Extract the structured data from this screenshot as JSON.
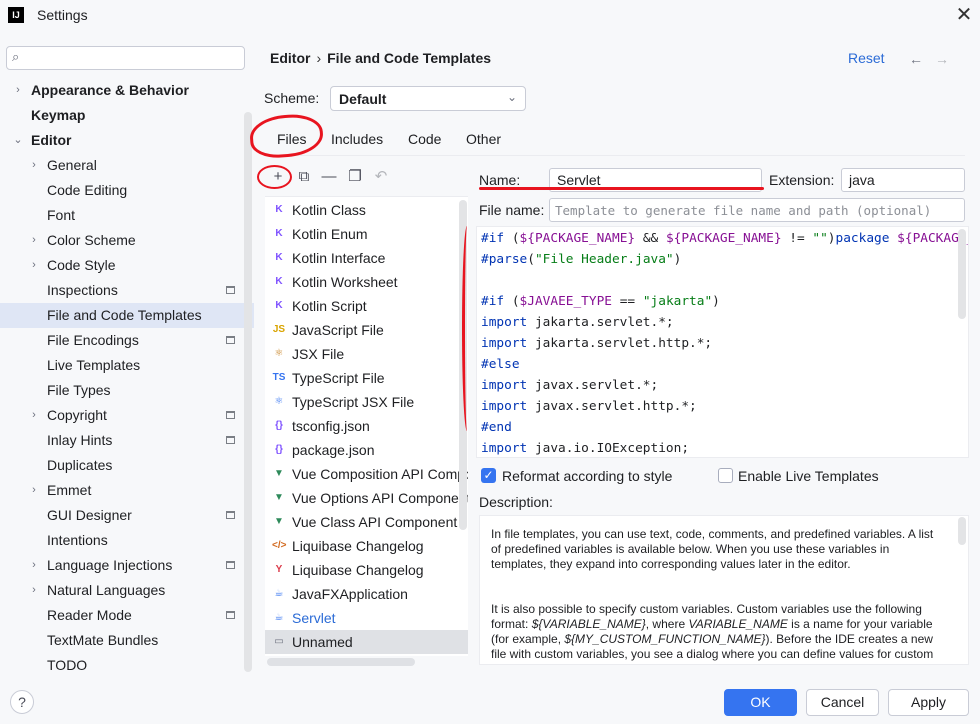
{
  "window": {
    "title": "Settings",
    "app_icon": "IJ",
    "close_glyph": "✕"
  },
  "search": {
    "placeholder": "",
    "icon": "search-icon",
    "glyph": "⌕"
  },
  "sidebar": {
    "items": [
      {
        "label": "Appearance & Behavior",
        "level": 0,
        "arrow": "›",
        "bold": true
      },
      {
        "label": "Keymap",
        "level": 0,
        "arrow": "",
        "bold": true
      },
      {
        "label": "Editor",
        "level": 0,
        "arrow": "⌄",
        "bold": true
      },
      {
        "label": "General",
        "level": 1,
        "arrow": "›"
      },
      {
        "label": "Code Editing",
        "level": 1,
        "arrow": ""
      },
      {
        "label": "Font",
        "level": 1,
        "arrow": ""
      },
      {
        "label": "Color Scheme",
        "level": 1,
        "arrow": "›"
      },
      {
        "label": "Code Style",
        "level": 1,
        "arrow": "›"
      },
      {
        "label": "Inspections",
        "level": 1,
        "arrow": "",
        "pin": true
      },
      {
        "label": "File and Code Templates",
        "level": 1,
        "arrow": "",
        "selected": true
      },
      {
        "label": "File Encodings",
        "level": 1,
        "arrow": "",
        "pin": true
      },
      {
        "label": "Live Templates",
        "level": 1,
        "arrow": ""
      },
      {
        "label": "File Types",
        "level": 1,
        "arrow": ""
      },
      {
        "label": "Copyright",
        "level": 1,
        "arrow": "›",
        "pin": true
      },
      {
        "label": "Inlay Hints",
        "level": 1,
        "arrow": "",
        "pin": true
      },
      {
        "label": "Duplicates",
        "level": 1,
        "arrow": ""
      },
      {
        "label": "Emmet",
        "level": 1,
        "arrow": "›"
      },
      {
        "label": "GUI Designer",
        "level": 1,
        "arrow": "",
        "pin": true
      },
      {
        "label": "Intentions",
        "level": 1,
        "arrow": ""
      },
      {
        "label": "Language Injections",
        "level": 1,
        "arrow": "›",
        "pin": true
      },
      {
        "label": "Natural Languages",
        "level": 1,
        "arrow": "›"
      },
      {
        "label": "Reader Mode",
        "level": 1,
        "arrow": "",
        "pin": true
      },
      {
        "label": "TextMate Bundles",
        "level": 1,
        "arrow": ""
      },
      {
        "label": "TODO",
        "level": 1,
        "arrow": ""
      }
    ]
  },
  "header": {
    "breadcrumb": [
      "Editor",
      "File and Code Templates"
    ],
    "breadcrumb_sep": "›",
    "reset": "Reset",
    "back": "←",
    "forward": "→"
  },
  "scheme": {
    "label": "Scheme:",
    "value": "Default",
    "chevron": "⌄"
  },
  "tabs": {
    "files": "Files",
    "includes": "Includes",
    "code": "Code",
    "other": "Other",
    "active": "Files"
  },
  "toolbar": {
    "add": "+",
    "copy_add": "⧉",
    "remove": "—",
    "duplicate": "❐",
    "reset": "↶",
    "icons": [
      "plus-icon",
      "add-copy-icon",
      "minus-icon",
      "copy-icon",
      "undo-icon"
    ]
  },
  "templates": [
    {
      "label": "Kotlin Class",
      "icon": "kotlin-icon",
      "glyph": "K",
      "color": "#7f52ff"
    },
    {
      "label": "Kotlin Enum",
      "icon": "kotlin-icon",
      "glyph": "K",
      "color": "#7f52ff"
    },
    {
      "label": "Kotlin Interface",
      "icon": "kotlin-icon",
      "glyph": "K",
      "color": "#7f52ff"
    },
    {
      "label": "Kotlin Worksheet",
      "icon": "kotlin-icon",
      "glyph": "K",
      "color": "#7f52ff"
    },
    {
      "label": "Kotlin Script",
      "icon": "kotlin-icon",
      "glyph": "K",
      "color": "#7f52ff"
    },
    {
      "label": "JavaScript File",
      "icon": "javascript-icon",
      "glyph": "JS",
      "color": "#d9a400"
    },
    {
      "label": "JSX File",
      "icon": "react-icon",
      "glyph": "⚛",
      "color": "#c57e1b"
    },
    {
      "label": "TypeScript File",
      "icon": "typescript-icon",
      "glyph": "TS",
      "color": "#3574f0"
    },
    {
      "label": "TypeScript JSX File",
      "icon": "react-icon",
      "glyph": "⚛",
      "color": "#3574f0"
    },
    {
      "label": "tsconfig.json",
      "icon": "json-icon",
      "glyph": "{}",
      "color": "#7f52ff"
    },
    {
      "label": "package.json",
      "icon": "json-icon",
      "glyph": "{}",
      "color": "#7f52ff"
    },
    {
      "label": "Vue Composition API Component",
      "icon": "vue-icon",
      "glyph": "▼",
      "color": "#2e8a5a"
    },
    {
      "label": "Vue Options API Component",
      "icon": "vue-icon",
      "glyph": "▼",
      "color": "#2e8a5a"
    },
    {
      "label": "Vue Class API Component",
      "icon": "vue-icon",
      "glyph": "▼",
      "color": "#2e8a5a"
    },
    {
      "label": "Liquibase Changelog",
      "icon": "xml-icon",
      "glyph": "</>",
      "color": "#d2691e"
    },
    {
      "label": "Liquibase Changelog",
      "icon": "yaml-icon",
      "glyph": "Y",
      "color": "#db3b4b"
    },
    {
      "label": "JavaFXApplication",
      "icon": "javafx-icon",
      "glyph": "☕",
      "color": "#3574f0"
    },
    {
      "label": "Servlet",
      "icon": "servlet-icon",
      "glyph": "☕",
      "color": "#3574f0",
      "link": true
    },
    {
      "label": "Unnamed",
      "icon": "file-icon",
      "glyph": "▭",
      "color": "#6c707e",
      "selected": true
    }
  ],
  "form": {
    "name_label": "Name:",
    "name_value": "Servlet",
    "extension_label": "Extension:",
    "extension_value": "java",
    "filename_label": "File name:",
    "filename_placeholder": "Template to generate file name and path (optional)"
  },
  "editor": {
    "lines": [
      "#if (${PACKAGE_NAME} && ${PACKAGE_NAME} != \"\")package ${PACKAGE_NAME};",
      "#parse(\"File Header.java\")",
      "",
      "#if ($JAVAEE_TYPE == \"jakarta\")",
      "import jakarta.servlet.*;",
      "import jakarta.servlet.http.*;",
      "#else",
      "import javax.servlet.*;",
      "import javax.servlet.http.*;",
      "#end",
      "import java.io.IOException;"
    ]
  },
  "options": {
    "reformat_label": "Reformat according to style",
    "reformat_checked": true,
    "live_label": "Enable Live Templates",
    "live_checked": false
  },
  "description": {
    "label": "Description:",
    "p1": "In file templates, you can use text, code, comments, and predefined variables. A list of predefined variables is available below. When you use these variables in templates, they expand into corresponding values later in the editor.",
    "p2a": "It is also possible to specify custom variables. Custom variables use the following format: ",
    "p2_var1": "${VARIABLE_NAME}",
    "p2b": ", where ",
    "p2_var2": "VARIABLE_NAME",
    "p2c": " is a name for your variable (for example, ",
    "p2_var3": "${MY_CUSTOM_FUNCTION_NAME}",
    "p2d": "). Before the IDE creates a new file with custom variables, you see a dialog where you can define values for custom variables in the template."
  },
  "buttons": {
    "help": "?",
    "ok": "OK",
    "cancel": "Cancel",
    "apply": "Apply"
  },
  "colors": {
    "accent": "#3574f0",
    "annotation": "#e8141f",
    "selection": "#dfe6f5"
  }
}
